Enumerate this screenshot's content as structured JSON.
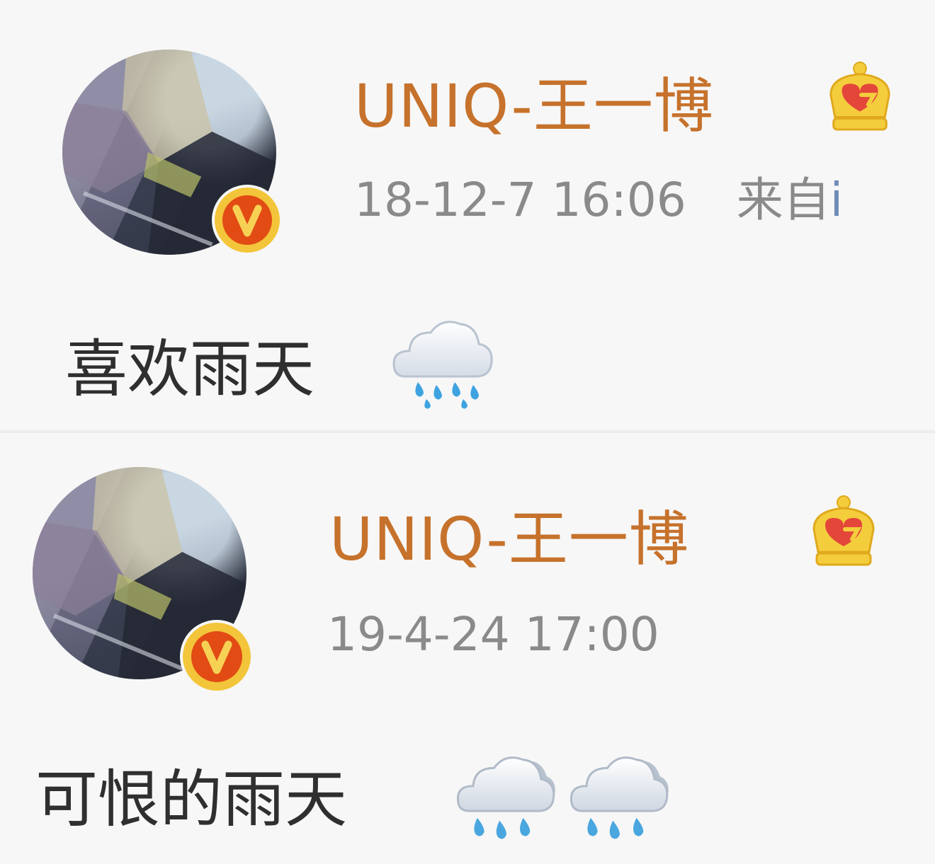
{
  "posts": [
    {
      "username": "UNIQ-王一博",
      "timestamp": "18-12-7 16:06",
      "source_prefix": "来自",
      "source_app": "i",
      "text": "喜欢雨天",
      "emoji": [
        "cloud-with-rain-icon"
      ],
      "avatar_icon": "avatar-photo",
      "verified_badge": "verified-v-icon",
      "member_icon": "crown-icon"
    },
    {
      "username": "UNIQ-王一博",
      "timestamp": "19-4-24 17:00",
      "text": "可恨的雨天",
      "emoji": [
        "cloud-with-rain-icon",
        "cloud-with-rain-icon"
      ],
      "avatar_icon": "avatar-photo",
      "verified_badge": "verified-v-icon",
      "member_icon": "crown-icon"
    }
  ],
  "colors": {
    "username": "#c6722c",
    "meta": "#8a8a8a",
    "text": "#2f2f2f",
    "background": "#f7f7f7",
    "badge_gold": "#f3c53a",
    "badge_red": "#e24b14"
  }
}
